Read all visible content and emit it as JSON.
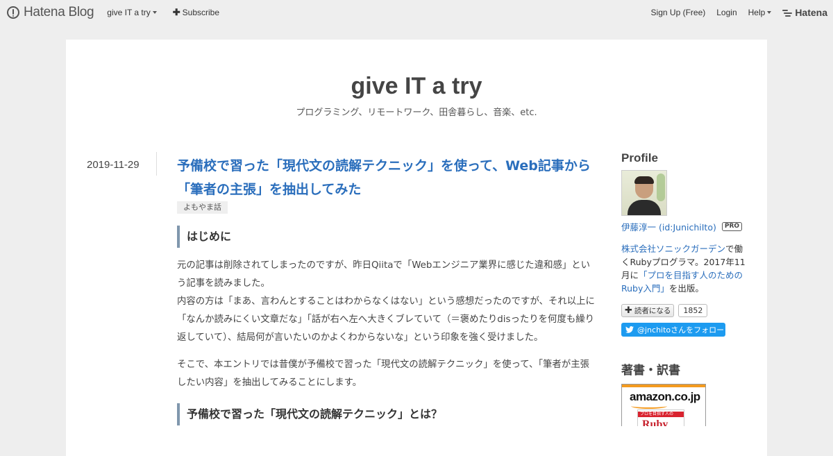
{
  "globalbar": {
    "logo": "Hatena Blog",
    "blog_menu": "give IT a try",
    "subscribe": "Subscribe",
    "signup": "Sign Up (Free)",
    "login": "Login",
    "help": "Help",
    "hatena": "Hatena"
  },
  "blog": {
    "title": "give IT a try",
    "description": "プログラミング、リモートワーク、田舎暮らし、音楽、etc."
  },
  "entry": {
    "date": "2019-11-29",
    "title": "予備校で習った「現代文の読解テクニック」を使って、Web記事から「筆者の主張」を抽出してみた",
    "category": "よもやま話",
    "heading1": "はじめに",
    "para1": "元の記事は削除されてしまったのですが、昨日Qiitaで「Webエンジニア業界に感じた違和感」という記事を読みました。",
    "para1b": "内容の方は「まあ、言わんとすることはわからなくはない」という感想だったのですが、それ以上に「なんか読みにくい文章だな」「話が右へ左へ大きくブレていて（＝褒めたりdisったりを何度も繰り返していて）、結局何が言いたいのかよくわからないな」という印象を強く受けました。",
    "para2": "そこで、本エントリでは昔僕が予備校で習った「現代文の読解テクニック」を使って、「筆者が主張したい内容」を抽出してみることにします。",
    "heading2": "予備校で習った「現代文の読解テクニック」とは？"
  },
  "sidebar": {
    "profile_title": "Profile",
    "profile_name": "伊藤淳一 (id:JunichiIto)",
    "pro_badge": "PRO",
    "company_link": "株式会社ソニックガーデン",
    "desc_a": "で働くRubyプログラマ。2017年11月に",
    "book_link": "「プロを目指す人のためのRuby入門」",
    "desc_b": "を出版。",
    "reader_button": "読者になる",
    "reader_count": "1852",
    "twitter_follow": "@jnchitoさんをフォロー",
    "books_title": "著書・訳書",
    "amazon_logo": "amazon.co.jp",
    "book_band": "プロを目指す人の",
    "book_big": "Ruby"
  }
}
